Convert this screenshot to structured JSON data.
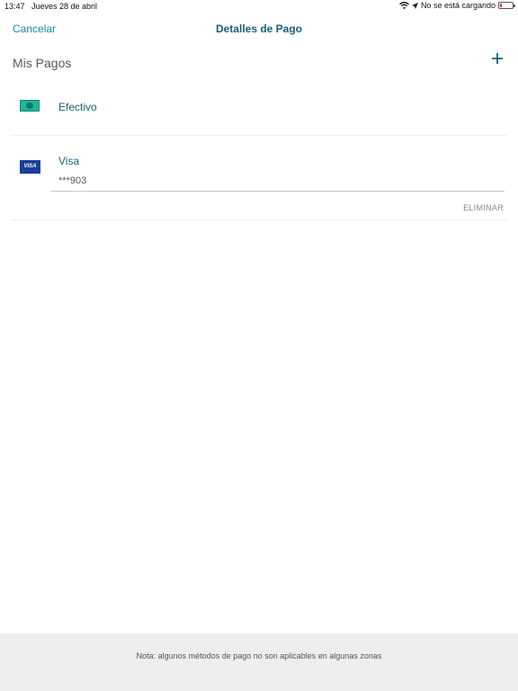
{
  "status_bar": {
    "time": "13:47",
    "date": "Jueves 28 de abril",
    "charging": "No se está cargando"
  },
  "nav": {
    "cancel_label": "Cancelar",
    "title": "Detalles de Pago"
  },
  "section": {
    "title": "Mis Pagos",
    "add_icon": "plus-icon"
  },
  "payment_methods": [
    {
      "label": "Efectivo",
      "icon": "cash-icon"
    },
    {
      "label": "Visa",
      "icon": "visa-card-icon",
      "card_logo_text": "VISA",
      "number": "***903",
      "action_label": "ELIMINAR"
    }
  ],
  "footer": {
    "note": "Nota: algunos métodos de pago no son aplicables en algunas zonas"
  },
  "colors": {
    "accent": "#1a86ad",
    "title": "#1c5e76",
    "cash": "#1fb596",
    "visa": "#1a3f9a"
  }
}
